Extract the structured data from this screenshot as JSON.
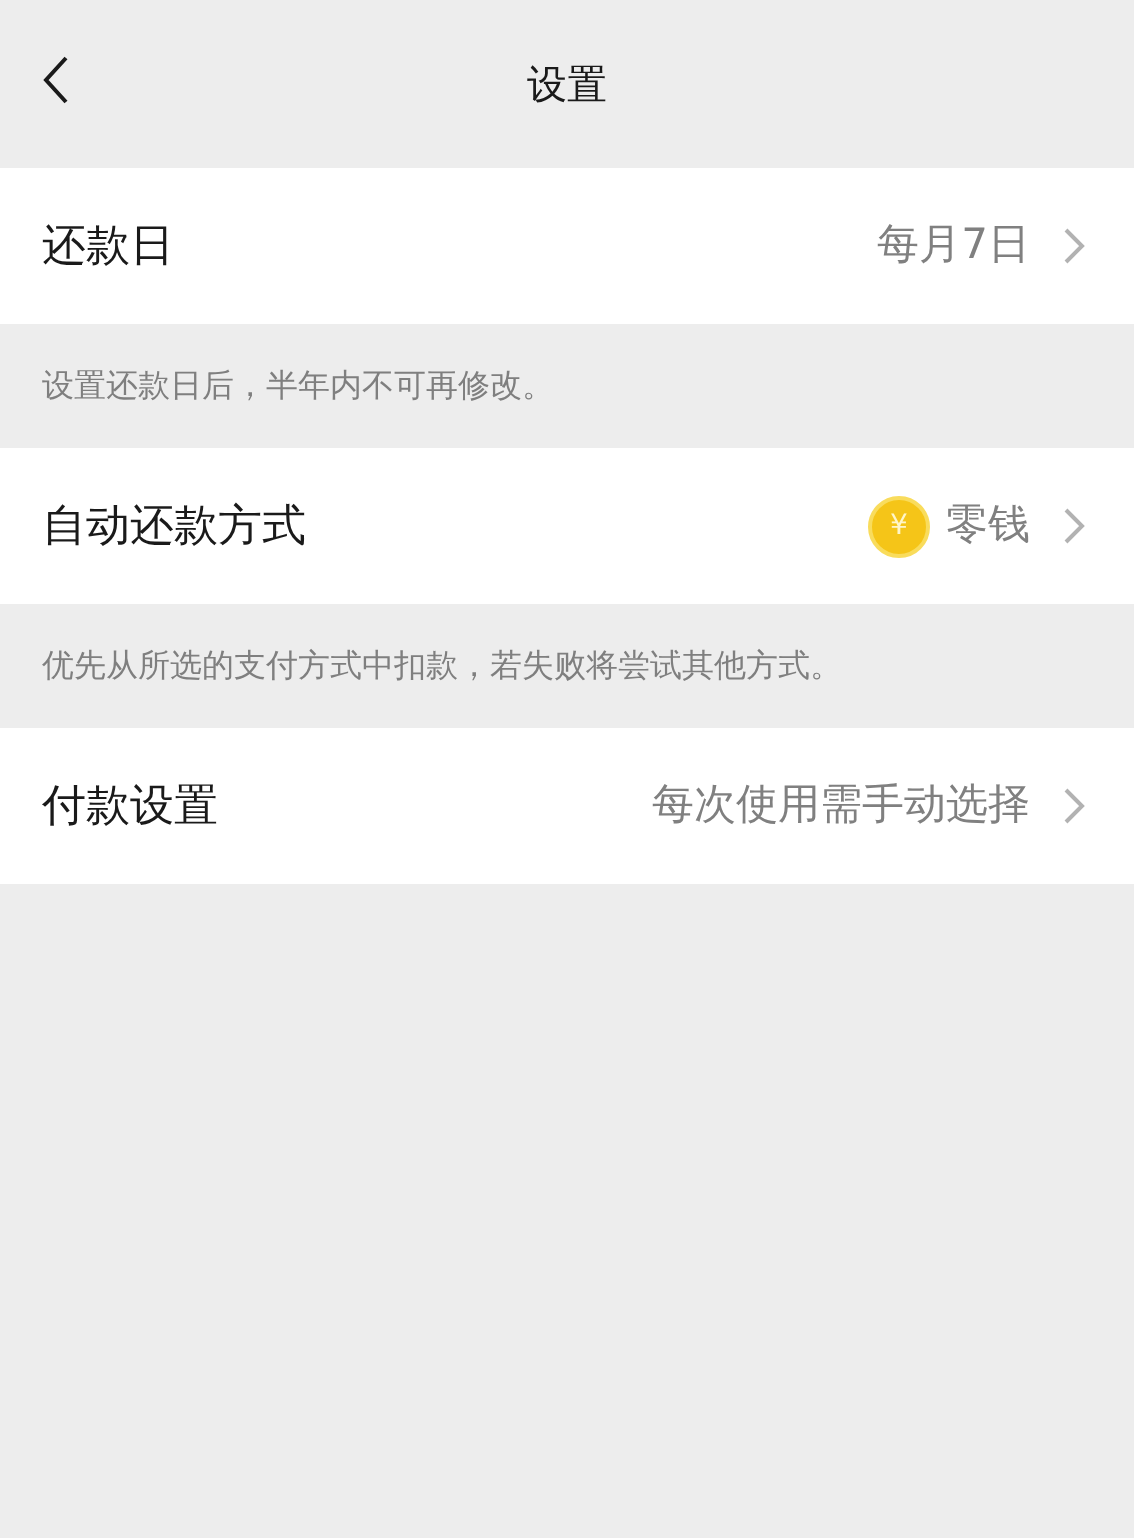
{
  "header": {
    "title": "设置"
  },
  "sections": [
    {
      "label": "还款日",
      "value": "每月7日",
      "kind": "plain",
      "note": "设置还款日后，半年内不可再修改。"
    },
    {
      "label": "自动还款方式",
      "value": "零钱",
      "kind": "coin",
      "coin_symbol": "¥",
      "note": "优先从所选的支付方式中扣款，若失败将尝试其他方式。"
    },
    {
      "label": "付款设置",
      "value": "每次使用需手动选择",
      "kind": "plain"
    }
  ]
}
